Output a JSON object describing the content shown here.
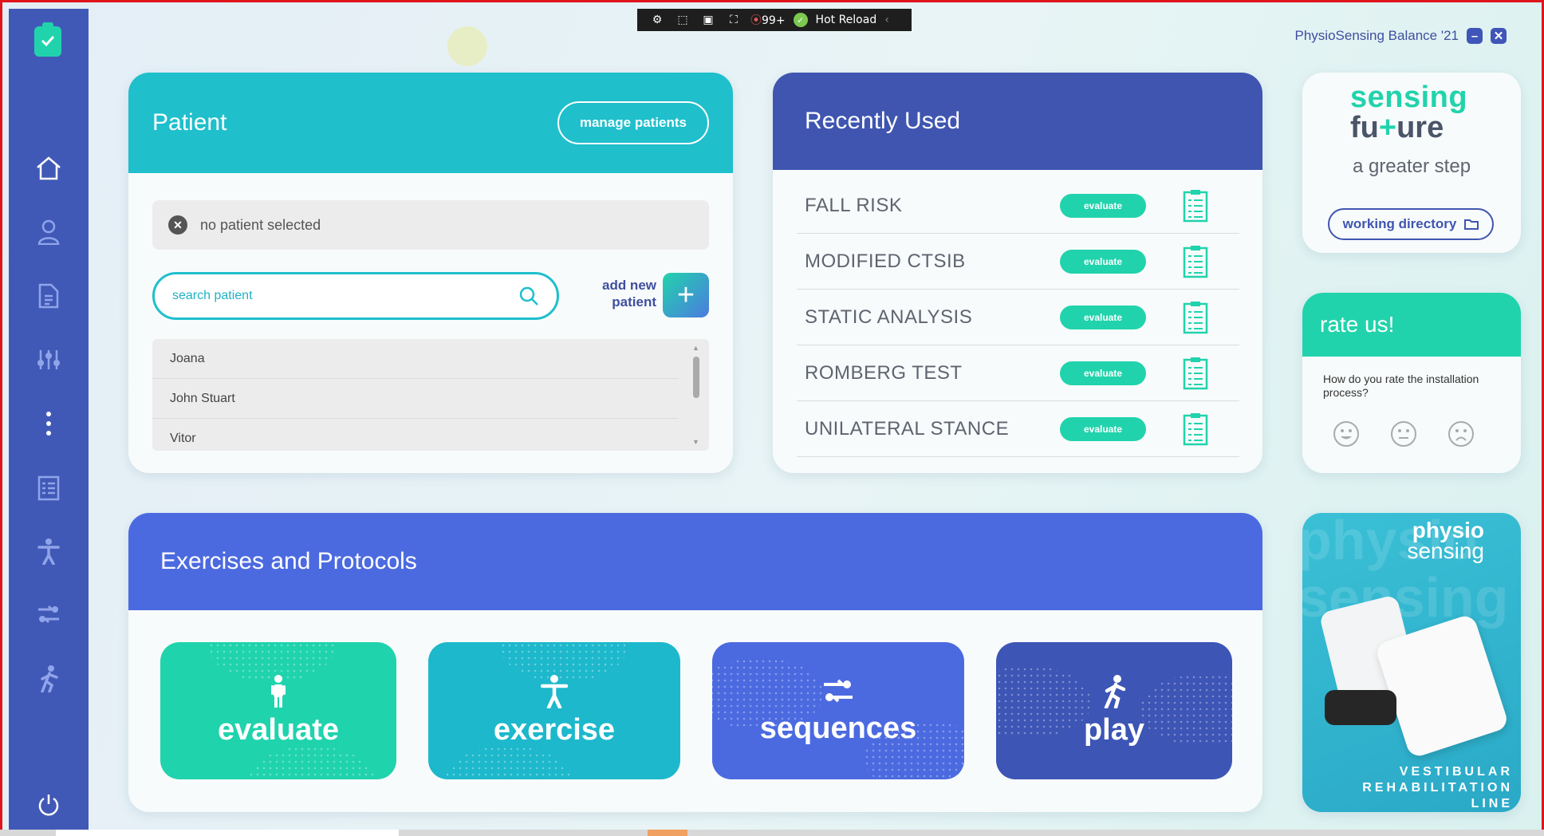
{
  "app": {
    "title": "PhysioSensing Balance '21",
    "minimize_label": "–",
    "close_label": "✕"
  },
  "devbar": {
    "count": "99+",
    "hot_reload": "Hot Reload",
    "arrow": "‹"
  },
  "sidebar": {
    "items": [
      {
        "name": "home",
        "icon": "home-icon"
      },
      {
        "name": "patient",
        "icon": "user-icon"
      },
      {
        "name": "document",
        "icon": "document-icon"
      },
      {
        "name": "settings",
        "icon": "sliders-icon"
      },
      {
        "name": "more",
        "icon": "more-vertical-icon"
      },
      {
        "name": "evaluate",
        "icon": "clipboard-icon"
      },
      {
        "name": "exercise",
        "icon": "person-icon"
      },
      {
        "name": "sequences",
        "icon": "sequence-icon"
      },
      {
        "name": "play",
        "icon": "running-icon"
      },
      {
        "name": "power",
        "icon": "power-icon"
      }
    ]
  },
  "patient": {
    "title": "Patient",
    "manage_label": "manage  patients",
    "no_selection": "no patient selected",
    "search_placeholder": "search patient",
    "add_new_line1": "add new",
    "add_new_line2": "patient",
    "add_symbol": "+",
    "list": [
      "Joana",
      "John Stuart",
      "Vitor"
    ]
  },
  "recent": {
    "title": "Recently Used",
    "evaluate_label": "evaluate",
    "items": [
      "FALL RISK",
      "MODIFIED CTSIB",
      "STATIC ANALYSIS",
      "ROMBERG TEST",
      "UNILATERAL STANCE"
    ]
  },
  "sensing": {
    "line1": "sensing",
    "line2a": "fu",
    "line2plus": "+",
    "line2b": "ure",
    "line3": "a greater step",
    "workdir_label": "working directory"
  },
  "rate": {
    "title": "rate us!",
    "question": "How do you rate the installation process?"
  },
  "exercises": {
    "title": "Exercises and Protocols",
    "tiles": [
      {
        "label": "evaluate",
        "color": "#1fd3ad"
      },
      {
        "label": "exercise",
        "color": "#1db8cc"
      },
      {
        "label": "sequences",
        "color": "#4c6ae0"
      },
      {
        "label": "play",
        "color": "#3d55b5"
      }
    ]
  },
  "promo": {
    "watermark1": "physio",
    "watermark2": "sensing",
    "logo1": "physio",
    "logo2": "sensing",
    "tag1": "VESTIBULAR",
    "tag2": "REHABILITATION",
    "tag3": "LINE"
  },
  "colors": {
    "sidebar": "#4159b6",
    "teal": "#1fbfcc",
    "green": "#21d3ac",
    "navy": "#3f55b0",
    "blue": "#4c6ae0"
  }
}
